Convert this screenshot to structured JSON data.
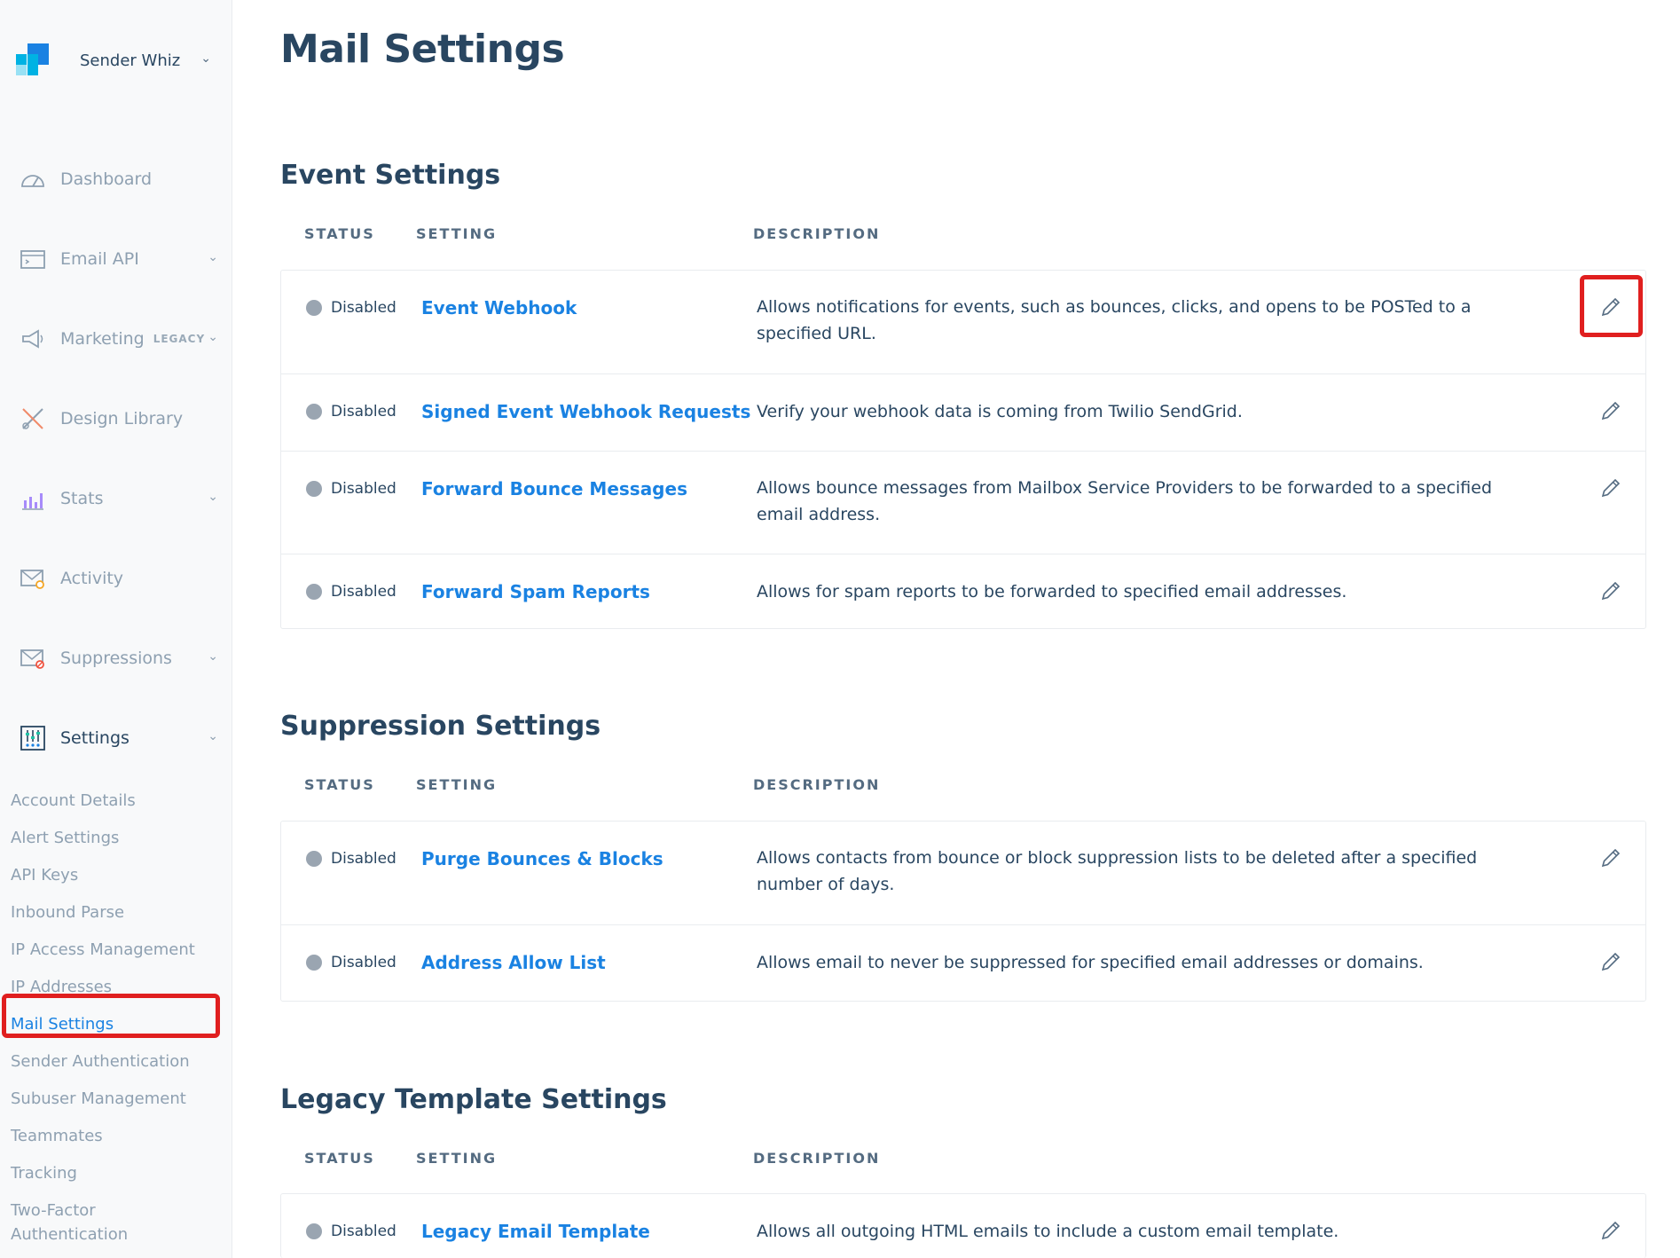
{
  "brand": {
    "name": "Sender Whiz"
  },
  "nav": [
    {
      "label": "Dashboard",
      "icon": "dashboard-icon",
      "chevron": false
    },
    {
      "label": "Email API",
      "icon": "email-api-icon",
      "chevron": true
    },
    {
      "label": "Marketing",
      "badge": "LEGACY",
      "icon": "megaphone-icon",
      "chevron": true
    },
    {
      "label": "Design Library",
      "icon": "design-library-icon",
      "chevron": false
    },
    {
      "label": "Stats",
      "icon": "stats-icon",
      "chevron": true
    },
    {
      "label": "Activity",
      "icon": "activity-icon",
      "chevron": false
    },
    {
      "label": "Suppressions",
      "icon": "suppressions-icon",
      "chevron": true
    },
    {
      "label": "Settings",
      "icon": "settings-icon",
      "chevron": true
    }
  ],
  "settings_sub": [
    "Account Details",
    "Alert Settings",
    "API Keys",
    "Inbound Parse",
    "IP Access Management",
    "IP Addresses",
    "Mail Settings",
    "Sender Authentication",
    "Subuser Management",
    "Teammates",
    "Tracking",
    "Two-Factor",
    "Authentication"
  ],
  "page": {
    "title": "Mail Settings"
  },
  "columns": {
    "status": "STATUS",
    "setting": "SETTING",
    "description": "DESCRIPTION"
  },
  "sections": [
    {
      "title": "Event Settings",
      "rows": [
        {
          "status": "Disabled",
          "setting": "Event Webhook",
          "description": "Allows notifications for events, such as bounces, clicks, and opens to be POSTed to a specified URL."
        },
        {
          "status": "Disabled",
          "setting": "Signed Event Webhook Requests",
          "description": "Verify your webhook data is coming from Twilio SendGrid."
        },
        {
          "status": "Disabled",
          "setting": "Forward Bounce Messages",
          "description": "Allows bounce messages from Mailbox Service Providers to be forwarded to a specified email address."
        },
        {
          "status": "Disabled",
          "setting": "Forward Spam Reports",
          "description": "Allows for spam reports to be forwarded to specified email addresses."
        }
      ]
    },
    {
      "title": "Suppression Settings",
      "rows": [
        {
          "status": "Disabled",
          "setting": "Purge Bounces & Blocks",
          "description": "Allows contacts from bounce or block suppression lists to be deleted after a specified number of days."
        },
        {
          "status": "Disabled",
          "setting": "Address Allow List",
          "description": "Allows email to never be suppressed for specified email addresses or domains."
        }
      ]
    },
    {
      "title": "Legacy Template Settings",
      "rows": [
        {
          "status": "Disabled",
          "setting": "Legacy Email Template",
          "description": "Allows all outgoing HTML emails to include a custom email template."
        }
      ]
    }
  ],
  "colors": {
    "link": "#1a82e2",
    "text": "#294661",
    "muted": "#8ea0b1",
    "highlight": "#e01f1f"
  }
}
